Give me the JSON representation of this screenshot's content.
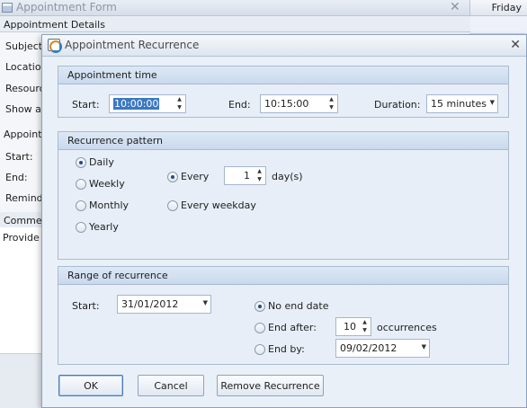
{
  "background_form": {
    "title": "Appointment Form",
    "day_header": "Friday",
    "section_details": "Appointment Details",
    "labels": [
      "Subject:",
      "Location",
      "Resource",
      "Show as"
    ],
    "section_appointment": "Appointment",
    "labels2": [
      "Start:",
      "End:",
      "Remind"
    ],
    "section_comments": "Comments",
    "comment_text": "Provide W"
  },
  "dialog": {
    "title": "Appointment Recurrence",
    "appointment_time": {
      "header": "Appointment time",
      "start_label": "Start:",
      "start_value": "10:00:00",
      "end_label": "End:",
      "end_value": "10:15:00",
      "duration_label": "Duration:",
      "duration_value": "15 minutes"
    },
    "recurrence_pattern": {
      "header": "Recurrence pattern",
      "options": [
        "Daily",
        "Weekly",
        "Monthly",
        "Yearly"
      ],
      "selected": "Daily",
      "every_label": "Every",
      "every_value": "1",
      "every_unit": "day(s)",
      "every_weekday_label": "Every weekday"
    },
    "range": {
      "header": "Range of recurrence",
      "start_label": "Start:",
      "start_value": "31/01/2012",
      "no_end_label": "No end date",
      "end_after_label": "End after:",
      "end_after_value": "10",
      "occurrences_label": "occurrences",
      "end_by_label": "End by:",
      "end_by_value": "09/02/2012"
    },
    "buttons": {
      "ok": "OK",
      "cancel": "Cancel",
      "remove": "Remove Recurrence"
    }
  }
}
